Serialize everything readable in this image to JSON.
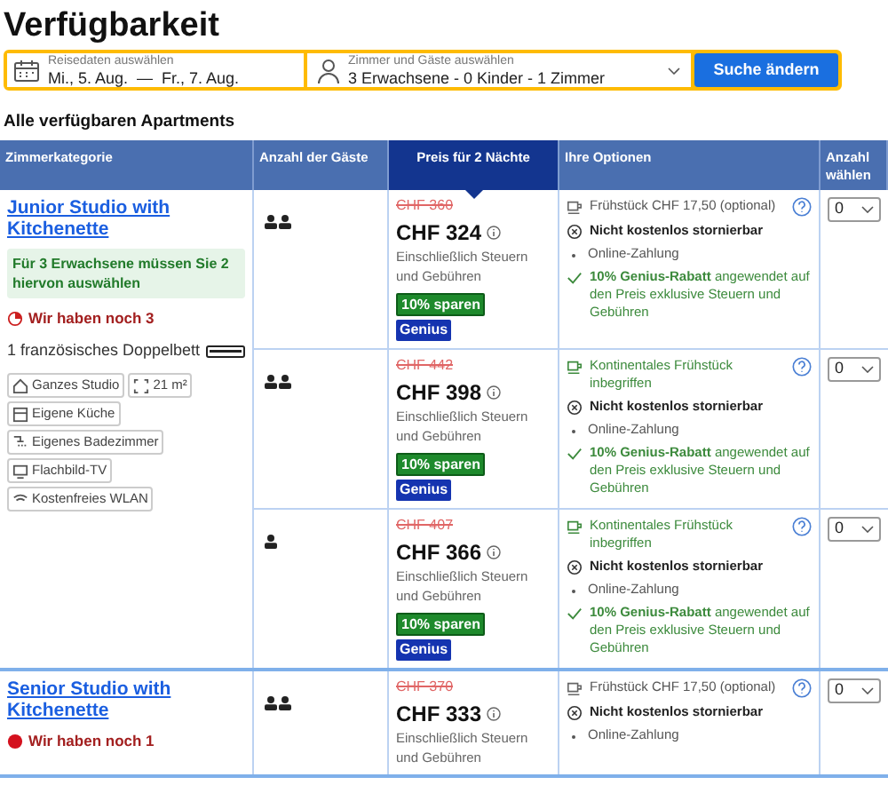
{
  "title": "Verfügbarkeit",
  "search": {
    "dates": {
      "label": "Reisedaten auswählen",
      "from": "Mi., 5. Aug.",
      "separator": "—",
      "to": "Fr., 7. Aug."
    },
    "guests": {
      "label": "Zimmer und Gäste auswählen",
      "value": "3 Erwachsene - 0 Kinder - 1 Zimmer"
    },
    "button": "Suche ändern"
  },
  "section_title": "Alle verfügbaren Apartments",
  "columns": [
    {
      "label": "Zimmerkategorie",
      "selected": false
    },
    {
      "label": "Anzahl der Gäste",
      "selected": false
    },
    {
      "label": "Preis für 2 Nächte",
      "selected": true
    },
    {
      "label": "Ihre Optionen",
      "selected": false
    },
    {
      "label": "Anzahl wählen",
      "selected": false
    }
  ],
  "rooms": [
    {
      "name": "Junior Studio with Kitchenette",
      "notice": "Für 3 Erwachsene müssen Sie 2 hiervon auswählen",
      "availability": {
        "kind": "clock",
        "text": "Wir haben noch 3"
      },
      "bed": "1 französisches Doppelbett",
      "facilities": [
        {
          "kind": "house",
          "label": "Ganzes Studio"
        },
        {
          "kind": "size",
          "label": "21 m²"
        },
        {
          "kind": "kitchen",
          "label": "Eigene Küche"
        },
        {
          "kind": "shower",
          "label": "Eigenes Badezimmer"
        },
        {
          "kind": "tv",
          "label": "Flachbild-TV"
        },
        {
          "kind": "wifi",
          "label": "Kostenfreies WLAN"
        }
      ],
      "offers": [
        {
          "occupancy": {
            "kind": "double"
          },
          "old_price": "CHF 360",
          "price": "CHF 324",
          "tax_note": "Einschließlich Steuern und Gebühren",
          "discount": "10% sparen",
          "badge": "Genius",
          "breakfast": {
            "included": false,
            "text": "Frühstück CHF 17,50 (optional)"
          },
          "cancellation": "Nicht kostenlos stornierbar",
          "payment": "Online-Zahlung",
          "genius_note": "**10% Genius-Rabatt** angewendet auf den Preis exklusive Steuern und Gebühren",
          "quantity": "0"
        },
        {
          "occupancy": {
            "kind": "double"
          },
          "old_price": "CHF 442",
          "price": "CHF 398",
          "tax_note": "Einschließlich Steuern und Gebühren",
          "discount": "10% sparen",
          "badge": "Genius",
          "breakfast": {
            "included": true,
            "text": "Kontinentales Frühstück inbegriffen"
          },
          "cancellation": "Nicht kostenlos stornierbar",
          "payment": "Online-Zahlung",
          "genius_note": "**10% Genius-Rabatt** angewendet auf den Preis exklusive Steuern und Gebühren",
          "quantity": "0"
        },
        {
          "occupancy": {
            "kind": "single"
          },
          "old_price": "CHF 407",
          "price": "CHF 366",
          "tax_note": "Einschließlich Steuern und Gebühren",
          "discount": "10% sparen",
          "badge": "Genius",
          "breakfast": {
            "included": true,
            "text": "Kontinentales Frühstück inbegriffen"
          },
          "cancellation": "Nicht kostenlos stornierbar",
          "payment": "Online-Zahlung",
          "genius_note": "**10% Genius-Rabatt** angewendet auf den Preis exklusive Steuern und Gebühren",
          "quantity": "0"
        }
      ]
    },
    {
      "name": "Senior Studio with Kitchenette",
      "availability": {
        "kind": "dot",
        "text": "Wir haben noch 1"
      },
      "offers": [
        {
          "occupancy": {
            "kind": "double"
          },
          "old_price": "CHF 370",
          "price": "CHF 333",
          "tax_note": "Einschließlich Steuern und Gebühren",
          "breakfast": {
            "included": false,
            "text": "Frühstück CHF 17,50 (optional)"
          },
          "cancellation": "Nicht kostenlos stornierbar",
          "payment": "Online-Zahlung",
          "quantity": "0"
        }
      ]
    }
  ]
}
